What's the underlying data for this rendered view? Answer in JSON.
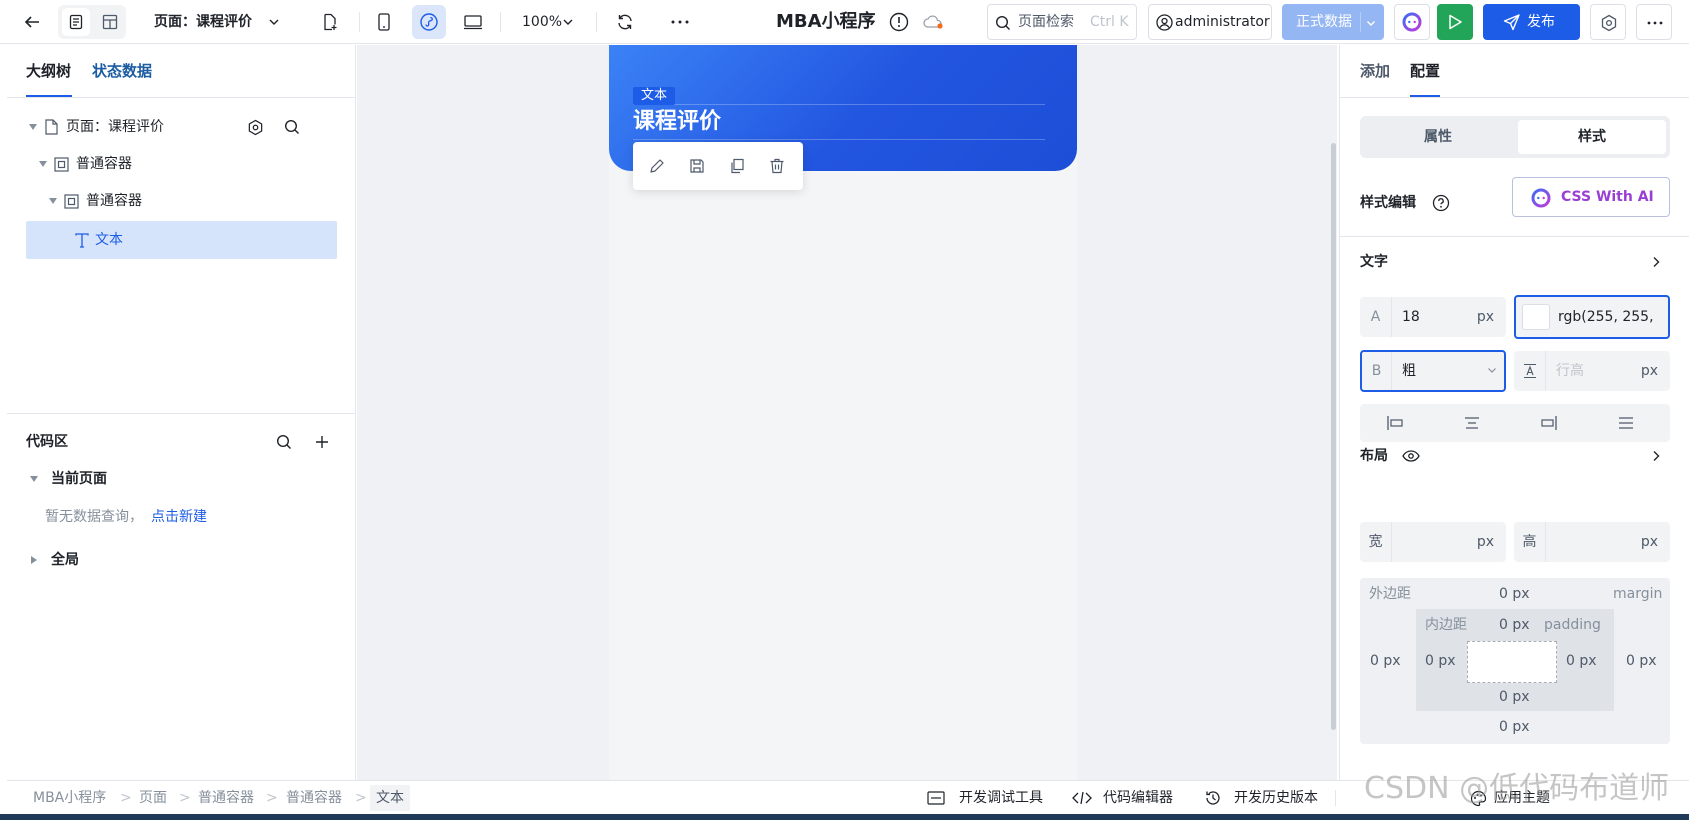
{
  "topbar": {
    "page_selector": "页面：课程评价",
    "zoom": "100%",
    "app_title": "MBA小程序",
    "search_placeholder": "页面检索",
    "search_shortcut": "Ctrl K",
    "user": "administrator",
    "env": "正式数据",
    "publish": "发布"
  },
  "left": {
    "tabs": [
      "大纲树",
      "状态数据"
    ],
    "tree": [
      {
        "label": "页面：课程评价"
      },
      {
        "label": "普通容器"
      },
      {
        "label": "普通容器"
      },
      {
        "label": "文本"
      }
    ],
    "code_title": "代码区",
    "current_page": "当前页面",
    "empty_text": "暂无数据查询，",
    "create_link": "点击新建",
    "global": "全局"
  },
  "canvas": {
    "text_tag": "文本",
    "heading": "课程评价"
  },
  "right": {
    "tabs": [
      "添加",
      "配置"
    ],
    "seg": [
      "属性",
      "样式"
    ],
    "style_edit": "样式编辑",
    "css_ai": "CSS With AI",
    "text_section": "文字",
    "font_size": "18",
    "unit_px": "px",
    "color_value": "rgb(255, 255,",
    "font_weight": "粗",
    "line_height_placeholder": "行高",
    "layout_section": "布局",
    "width_label": "宽",
    "height_label": "高",
    "margin_label": "外边距",
    "margin_en": "margin",
    "padding_label": "内边距",
    "padding_en": "padding",
    "zero_px": "0 px"
  },
  "bottom": {
    "breadcrumb": [
      "MBA小程序",
      "页面",
      "普通容器",
      "普通容器",
      "文本"
    ],
    "devtools": "开发调试工具",
    "code_editor": "代码编辑器",
    "history": "开发历史版本",
    "theme": "应用主题"
  },
  "watermark": "CSDN @低代码布道师",
  "colors": {
    "accent": "#1d5ce6",
    "hero_start": "#3b82f6",
    "hero_end": "#1d4ed8",
    "selected": "#d6e4fb"
  }
}
